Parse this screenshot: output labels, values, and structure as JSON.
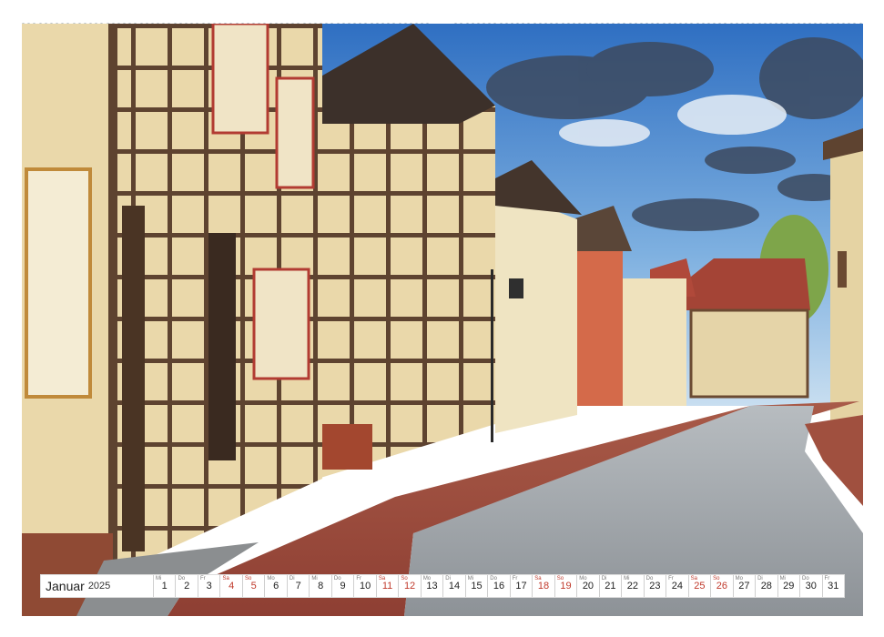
{
  "calendar": {
    "month": "Januar",
    "year": "2025",
    "days": [
      {
        "wd": "Mi",
        "d": "1",
        "we": false
      },
      {
        "wd": "Do",
        "d": "2",
        "we": false
      },
      {
        "wd": "Fr",
        "d": "3",
        "we": false
      },
      {
        "wd": "Sa",
        "d": "4",
        "we": true
      },
      {
        "wd": "So",
        "d": "5",
        "we": true
      },
      {
        "wd": "Mo",
        "d": "6",
        "we": false
      },
      {
        "wd": "Di",
        "d": "7",
        "we": false
      },
      {
        "wd": "Mi",
        "d": "8",
        "we": false
      },
      {
        "wd": "Do",
        "d": "9",
        "we": false
      },
      {
        "wd": "Fr",
        "d": "10",
        "we": false
      },
      {
        "wd": "Sa",
        "d": "11",
        "we": true
      },
      {
        "wd": "So",
        "d": "12",
        "we": true
      },
      {
        "wd": "Mo",
        "d": "13",
        "we": false
      },
      {
        "wd": "Di",
        "d": "14",
        "we": false
      },
      {
        "wd": "Mi",
        "d": "15",
        "we": false
      },
      {
        "wd": "Do",
        "d": "16",
        "we": false
      },
      {
        "wd": "Fr",
        "d": "17",
        "we": false
      },
      {
        "wd": "Sa",
        "d": "18",
        "we": true
      },
      {
        "wd": "So",
        "d": "19",
        "we": true
      },
      {
        "wd": "Mo",
        "d": "20",
        "we": false
      },
      {
        "wd": "Di",
        "d": "21",
        "we": false
      },
      {
        "wd": "Mi",
        "d": "22",
        "we": false
      },
      {
        "wd": "Do",
        "d": "23",
        "we": false
      },
      {
        "wd": "Fr",
        "d": "24",
        "we": false
      },
      {
        "wd": "Sa",
        "d": "25",
        "we": true
      },
      {
        "wd": "So",
        "d": "26",
        "we": true
      },
      {
        "wd": "Mo",
        "d": "27",
        "we": false
      },
      {
        "wd": "Di",
        "d": "28",
        "we": false
      },
      {
        "wd": "Mi",
        "d": "29",
        "we": false
      },
      {
        "wd": "Do",
        "d": "30",
        "we": false
      },
      {
        "wd": "Fr",
        "d": "31",
        "we": false
      }
    ]
  },
  "colors": {
    "weekend": "#c0392b",
    "sky": "#4f86c6",
    "timber": "#6b4a32",
    "plaster": "#e9d6a6",
    "brick_sidewalk": "#9b4a3c",
    "cobble": "#9ea3a8"
  }
}
